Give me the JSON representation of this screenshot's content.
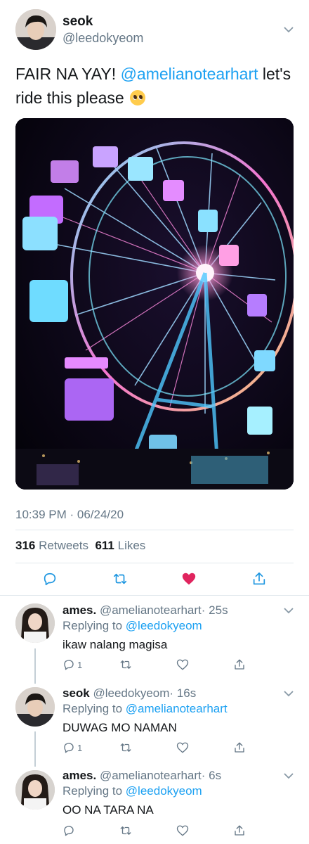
{
  "tweet": {
    "name": "seok",
    "handle": "@leedokyeom",
    "text_before": "FAIR NA YAY! ",
    "mention": "@amelianotearhart",
    "text_after": " let's ride this please",
    "emoji": "pleading-face-emoji",
    "timestamp": "10:39 PM · 06/24/20",
    "retweets_count": "316",
    "retweets_label": "Retweets",
    "likes_count": "611",
    "likes_label": "Likes",
    "liked": true
  },
  "replies": [
    {
      "name": "ames.",
      "handle": "@amelianotearhart",
      "time": "· 25s",
      "replying_label": "Replying to",
      "replying_to": "@leedokyeom",
      "text": "ikaw nalang magisa",
      "reply_count": "1"
    },
    {
      "name": "seok",
      "handle": "@leedokyeom",
      "time": "· 16s",
      "replying_label": "Replying to",
      "replying_to": "@amelianotearhart",
      "text": "DUWAG MO NAMAN",
      "reply_count": "1"
    },
    {
      "name": "ames.",
      "handle": "@amelianotearhart",
      "time": "· 6s",
      "replying_label": "Replying to",
      "replying_to": "@leedokyeom",
      "text": "OO NA TARA NA",
      "reply_count": ""
    }
  ],
  "colors": {
    "accent": "#1da1f2",
    "like": "#e0245e",
    "muted": "#657786",
    "text": "#14171a"
  }
}
